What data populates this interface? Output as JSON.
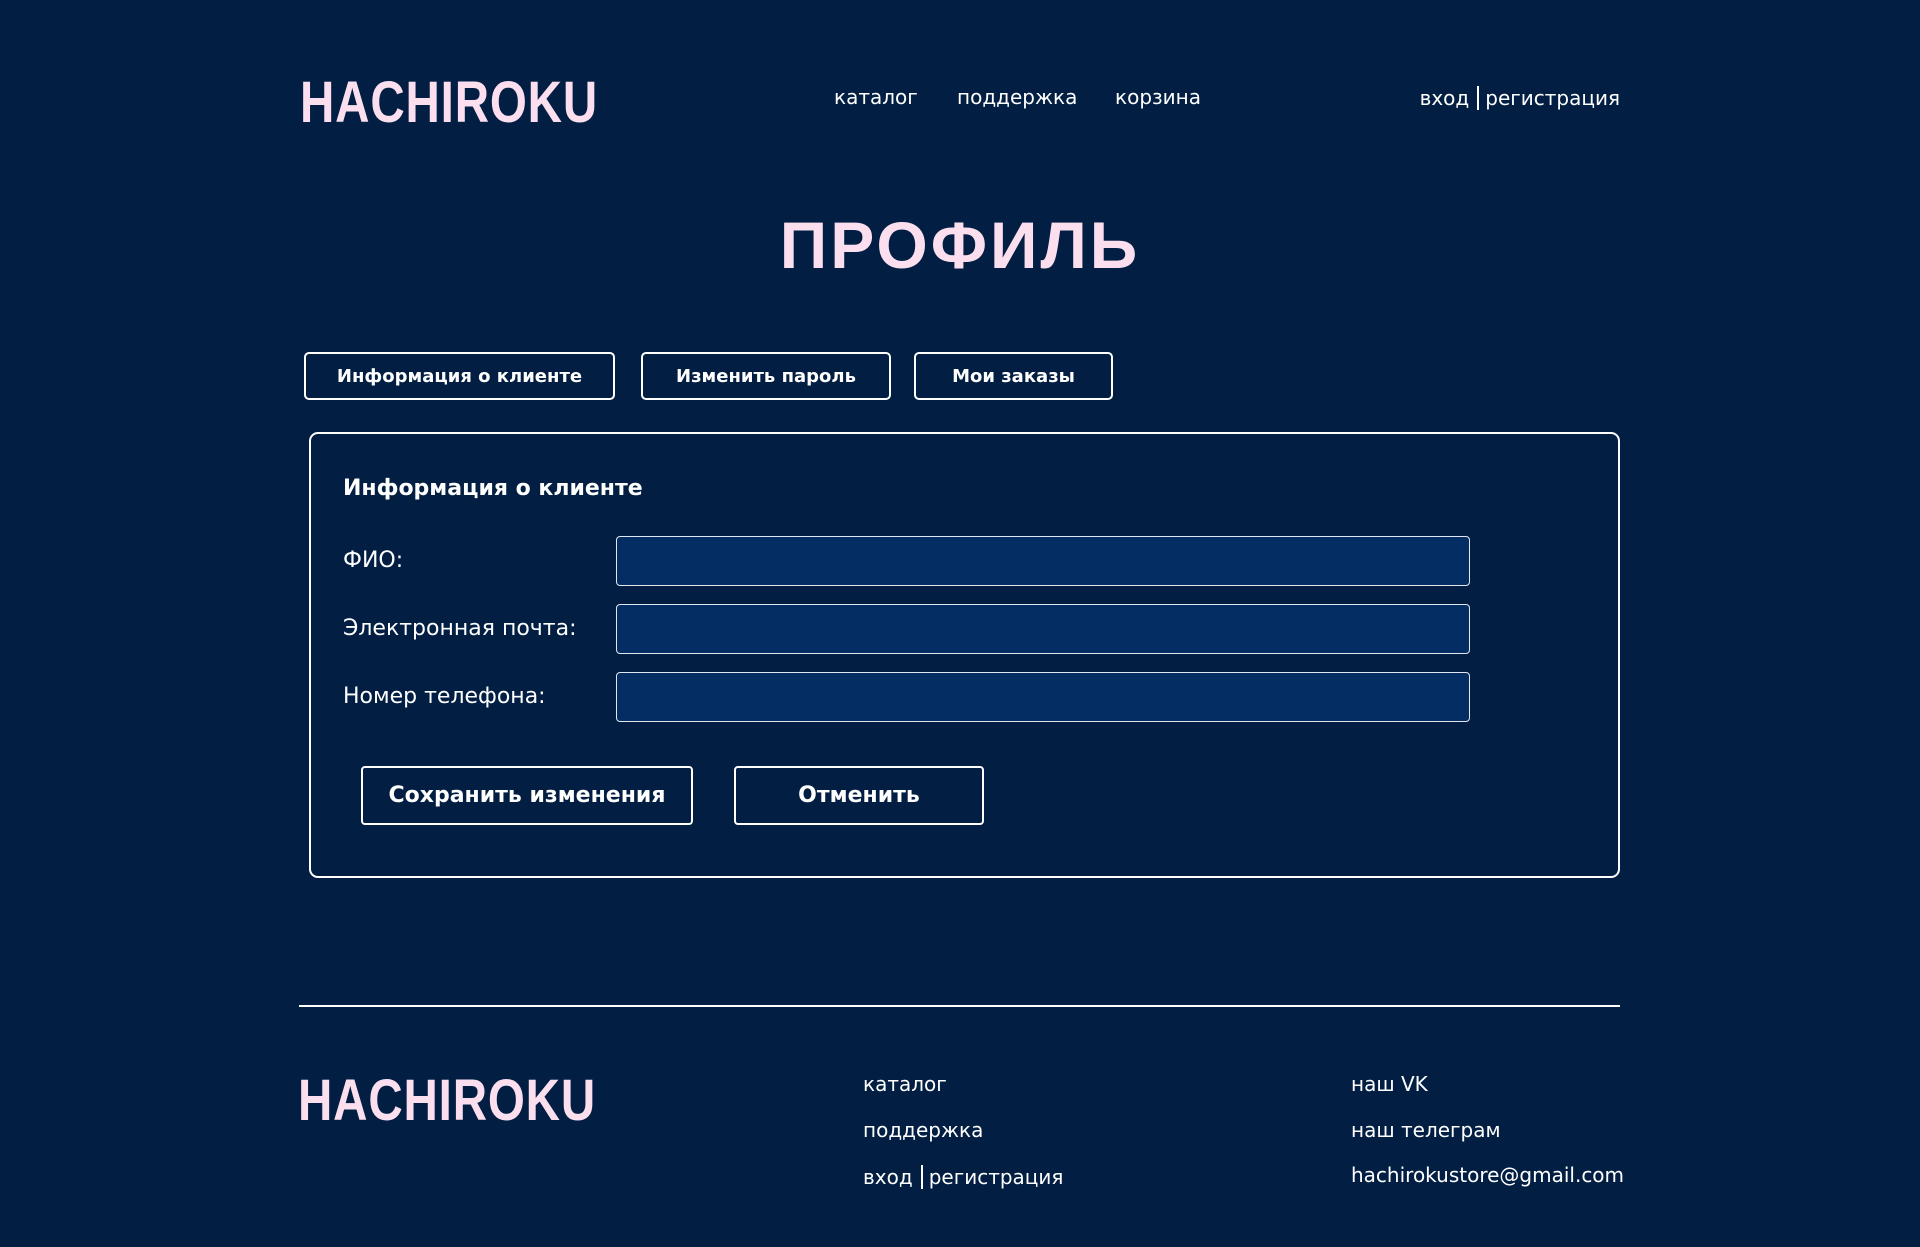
{
  "header": {
    "logo": "HACHIROKU",
    "nav": {
      "catalog": "каталог",
      "support": "поддержка",
      "cart": "корзина"
    },
    "auth": {
      "login": "вход",
      "register": "регистрация"
    }
  },
  "page": {
    "title": "ПРОФИЛЬ"
  },
  "tabs": {
    "client_info": "Информация о клиенте",
    "change_password": "Изменить пароль",
    "my_orders": "Мои заказы"
  },
  "panel": {
    "title": "Информация о клиенте",
    "fields": {
      "fio_label": "ФИО:",
      "fio_value": "",
      "email_label": "Электронная почта:",
      "email_value": "",
      "phone_label": "Номер телефона:",
      "phone_value": ""
    },
    "save_label": "Сохранить изменения",
    "cancel_label": "Отменить"
  },
  "footer": {
    "logo": "HACHIROKU",
    "links": {
      "catalog": "каталог",
      "support": "поддержка",
      "login": "вход",
      "register": "регистрация"
    },
    "contacts": {
      "vk": "наш VK",
      "telegram": "наш телеграм",
      "email": "hachirokustore@gmail.com"
    }
  },
  "colors": {
    "background": "#021f43",
    "input_background": "#032d63",
    "logo_pink": "#fbdfee",
    "text": "#ffffff"
  }
}
